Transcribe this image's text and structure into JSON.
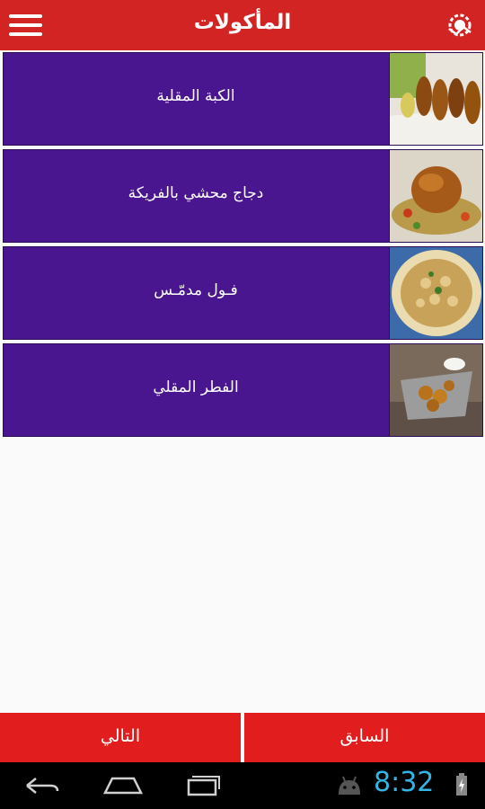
{
  "header": {
    "title": "المأكولات",
    "menu_icon": "hamburger-menu-icon",
    "logo_icon": "app-logo-icon"
  },
  "list": {
    "items": [
      {
        "label": "الكبة المقلية",
        "image": "fried-kibbeh-photo"
      },
      {
        "label": "دجاج محشي بالفريكة",
        "image": "stuffed-chicken-photo"
      },
      {
        "label": "فـول مدمّـس",
        "image": "ful-medames-photo"
      },
      {
        "label": "الفطر المقلي",
        "image": "fried-mushroom-photo"
      }
    ]
  },
  "footer": {
    "next_label": "التالي",
    "prev_label": "السابق"
  },
  "system_bar": {
    "time": "8:32",
    "icons": [
      "back-icon",
      "home-icon",
      "recent-apps-icon",
      "android-icon",
      "battery-icon"
    ]
  },
  "colors": {
    "header_bg": "#d32424",
    "item_bg": "#4a1690",
    "button_bg": "#e21d1d",
    "clock": "#33b5e5"
  }
}
